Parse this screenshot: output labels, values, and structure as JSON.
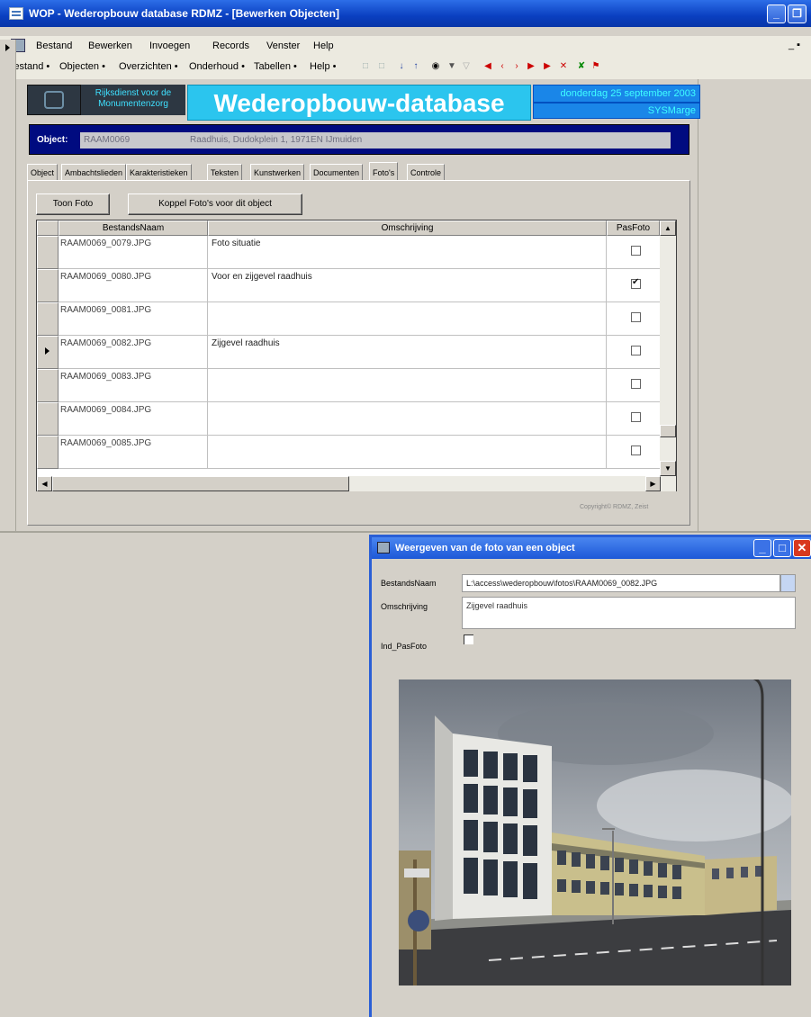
{
  "window": {
    "title": "WOP - Wederopbouw database RDMZ - [Bewerken Objecten]",
    "minimize_glyph": "_",
    "maximize_glyph": "❐"
  },
  "menubar": {
    "items": [
      "Bestand",
      "Bewerken",
      "Invoegen",
      "Records",
      "Venster",
      "Help"
    ],
    "restore_glyph": "_ ▪"
  },
  "toolbar": {
    "items": [
      "Bestand •",
      "Objecten •",
      "Overzichten •",
      "Onderhoud •",
      "Tabellen •",
      "Help •"
    ]
  },
  "header": {
    "org_name": "Rijksdienst voor de Monumentenzorg",
    "app_title": "Wederopbouw-database",
    "date": "donderdag 25 september 2003",
    "user": "SYSMarge"
  },
  "object": {
    "label": "Object:",
    "id": "RAAM0069",
    "description": "Raadhuis, Dudokplein 1, 1971EN IJmuiden"
  },
  "tabs": [
    {
      "label": "Object",
      "active": false
    },
    {
      "label": "Ambachtslieden",
      "active": false
    },
    {
      "label": "Karakteristieken",
      "active": false
    },
    {
      "label": "Teksten",
      "active": false
    },
    {
      "label": "Kunstwerken",
      "active": false
    },
    {
      "label": "Documenten",
      "active": false
    },
    {
      "label": "Foto's",
      "active": true
    },
    {
      "label": "Controle",
      "active": false
    }
  ],
  "buttons": {
    "toon_foto": "Toon Foto",
    "koppel": "Koppel Foto's voor dit object"
  },
  "grid": {
    "columns": [
      "BestandsNaam",
      "Omschrijving",
      "PasFoto"
    ],
    "rows": [
      {
        "file": "RAAM0069_0079.JPG",
        "desc": "Foto situatie",
        "pasfoto": false,
        "current": false
      },
      {
        "file": "RAAM0069_0080.JPG",
        "desc": "Voor en zijgevel raadhuis",
        "pasfoto": true,
        "current": false
      },
      {
        "file": "RAAM0069_0081.JPG",
        "desc": "",
        "pasfoto": false,
        "current": false
      },
      {
        "file": "RAAM0069_0082.JPG",
        "desc": "Zijgevel raadhuis",
        "pasfoto": false,
        "current": true
      },
      {
        "file": "RAAM0069_0083.JPG",
        "desc": "",
        "pasfoto": false,
        "current": false
      },
      {
        "file": "RAAM0069_0084.JPG",
        "desc": "",
        "pasfoto": false,
        "current": false
      },
      {
        "file": "RAAM0069_0085.JPG",
        "desc": "",
        "pasfoto": false,
        "current": false
      }
    ]
  },
  "copyright": "Copyright© RDMZ, Zeist",
  "dialog": {
    "title": "Weergeven van de foto van een object",
    "labels": {
      "bestandsnaam": "BestandsNaam",
      "omschrijving": "Omschrijving",
      "ind_pasfoto": "Ind_PasFoto"
    },
    "values": {
      "bestandsnaam": "L:\\access\\wederopbouw\\fotos\\RAAM0069_0082.JPG",
      "omschrijving": "Zijgevel raadhuis"
    },
    "ind_pasfoto": false,
    "photo": "photo-of-town-hall-building"
  },
  "colors": {
    "titlebar": "#0a3fc0",
    "header_cyan": "#2bc5ee",
    "object_bar": "#000b80",
    "dialog_close": "#d9381e"
  }
}
